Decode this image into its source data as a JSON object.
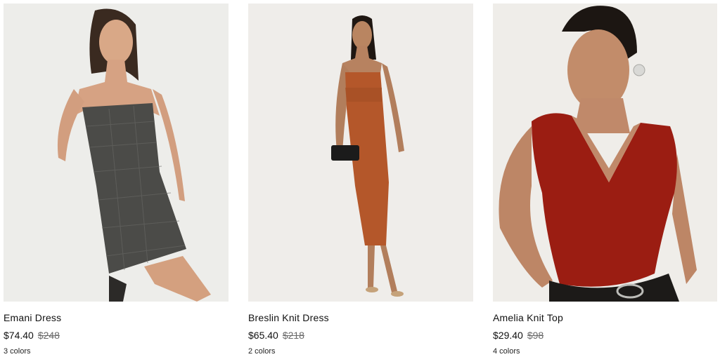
{
  "products": [
    {
      "name": "Emani Dress",
      "sale_price": "$74.40",
      "original_price": "$248",
      "colors": "3 colors",
      "image_label": "model-wearing-grey-plaid-strapless-dress",
      "accent": "#4a4a48"
    },
    {
      "name": "Breslin Knit Dress",
      "sale_price": "$65.40",
      "original_price": "$218",
      "colors": "2 colors",
      "image_label": "model-wearing-rust-knit-midi-dress",
      "accent": "#b5582a"
    },
    {
      "name": "Amelia Knit Top",
      "sale_price": "$29.40",
      "original_price": "$98",
      "colors": "4 colors",
      "image_label": "model-wearing-red-velvet-wrap-top",
      "accent": "#9a1c12"
    }
  ]
}
